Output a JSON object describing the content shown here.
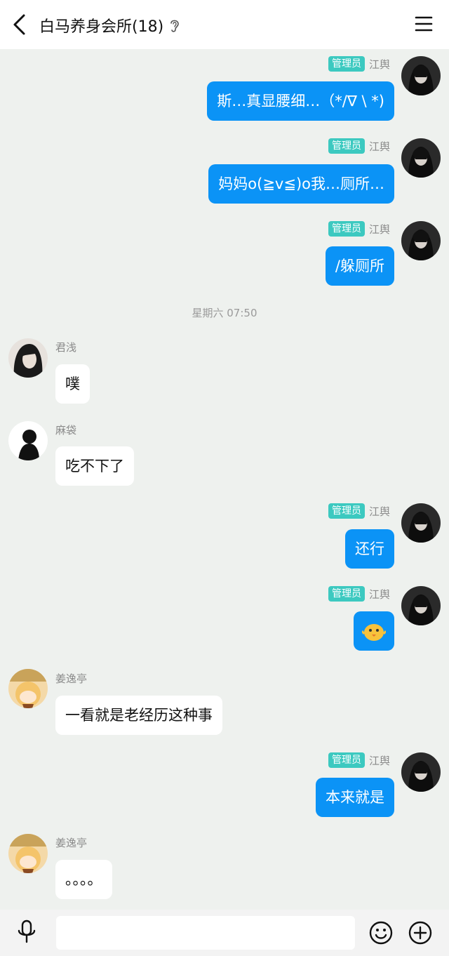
{
  "header": {
    "title": "白马养身会所(18)"
  },
  "messages_right": [
    {
      "badge": "管理员",
      "sender": "江舆",
      "text": "斯…真显腰细…（*/∇ \\ *)"
    },
    {
      "badge": "管理员",
      "sender": "江舆",
      "text": "妈妈o(≧v≦)o我…厕所…"
    },
    {
      "badge": "管理员",
      "sender": "江舆",
      "text": "/躲厕所"
    },
    {
      "badge": "管理员",
      "sender": "江舆",
      "text": "还行"
    },
    {
      "badge": "管理员",
      "sender": "江舆",
      "text": ""
    },
    {
      "badge": "管理员",
      "sender": "江舆",
      "text": "本来就是"
    }
  ],
  "time_divider": "星期六 07:50",
  "messages_left": [
    {
      "sender": "君浅",
      "text": "噗"
    },
    {
      "sender": "麻袋",
      "text": "吃不下了"
    },
    {
      "sender": "姜逸亭",
      "text": "一看就是老经历这种事"
    },
    {
      "sender": "姜逸亭",
      "text": "。。。。"
    }
  ],
  "icons": {
    "back": "back-arrow-icon",
    "ear": "ear-icon",
    "menu": "menu-icon",
    "mic": "microphone-icon",
    "emoji": "smiley-icon",
    "plus": "plus-circle-icon",
    "sticker": "chick-sticker-icon"
  },
  "colors": {
    "accent": "#0b93f6",
    "badge": "#3cc9c0",
    "background": "#eef1ee"
  }
}
